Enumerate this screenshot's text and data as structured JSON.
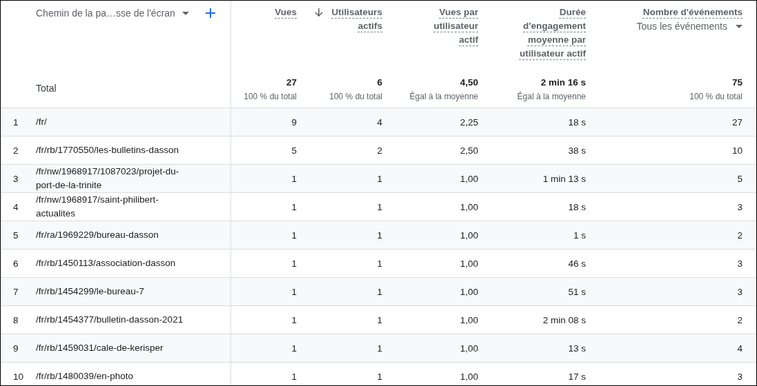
{
  "dimension": {
    "label": "Chemin de la pa…sse de l'écran"
  },
  "metrics": [
    {
      "label": "Vues",
      "sorted_descending": false
    },
    {
      "label": "Utilisateurs\nactifs",
      "sorted_descending": true
    },
    {
      "label": "Vues par\nutilisateur\nactif",
      "sorted_descending": false
    },
    {
      "label": "Durée\nd'engagement\nmoyenne par\nutilisateur actif",
      "sorted_descending": false
    },
    {
      "label": "Nombre d'événements",
      "sorted_descending": false,
      "dropdown": "Tous les événements"
    }
  ],
  "totals": {
    "label": "Total",
    "values": [
      {
        "value": "27",
        "note": "100 % du total"
      },
      {
        "value": "6",
        "note": "100 % du total"
      },
      {
        "value": "4,50",
        "note": "Égal à la moyenne"
      },
      {
        "value": "2 min 16 s",
        "note": "Égal à la moyenne"
      },
      {
        "value": "75",
        "note": "100 % du total"
      }
    ]
  },
  "rows": [
    {
      "index": "1",
      "path": "/fr/",
      "values": [
        "9",
        "4",
        "2,25",
        "18 s",
        "27"
      ]
    },
    {
      "index": "2",
      "path": "/fr/rb/1770550/les-bulletins-dasson",
      "values": [
        "5",
        "2",
        "2,50",
        "38 s",
        "10"
      ]
    },
    {
      "index": "3",
      "path": "/fr/nw/1968917/1087023/projet-du-port-de-la-trinite",
      "values": [
        "1",
        "1",
        "1,00",
        "1 min 13 s",
        "5"
      ]
    },
    {
      "index": "4",
      "path": "/fr/nw/1968917/saint-philibert-actualites",
      "values": [
        "1",
        "1",
        "1,00",
        "18 s",
        "3"
      ]
    },
    {
      "index": "5",
      "path": "/fr/ra/1969229/bureau-dasson",
      "values": [
        "1",
        "1",
        "1,00",
        "1 s",
        "2"
      ]
    },
    {
      "index": "6",
      "path": "/fr/rb/1450113/association-dasson",
      "values": [
        "1",
        "1",
        "1,00",
        "46 s",
        "3"
      ]
    },
    {
      "index": "7",
      "path": "/fr/rb/1454299/le-bureau-7",
      "values": [
        "1",
        "1",
        "1,00",
        "51 s",
        "3"
      ]
    },
    {
      "index": "8",
      "path": "/fr/rb/1454377/bulletin-dasson-2021",
      "values": [
        "1",
        "1",
        "1,00",
        "2 min 08 s",
        "2"
      ]
    },
    {
      "index": "9",
      "path": "/fr/rb/1459031/cale-de-kerisper",
      "values": [
        "1",
        "1",
        "1,00",
        "13 s",
        "4"
      ]
    },
    {
      "index": "10",
      "path": "/fr/rb/1480039/en-photo",
      "values": [
        "1",
        "1",
        "1,00",
        "17 s",
        "3"
      ]
    }
  ]
}
